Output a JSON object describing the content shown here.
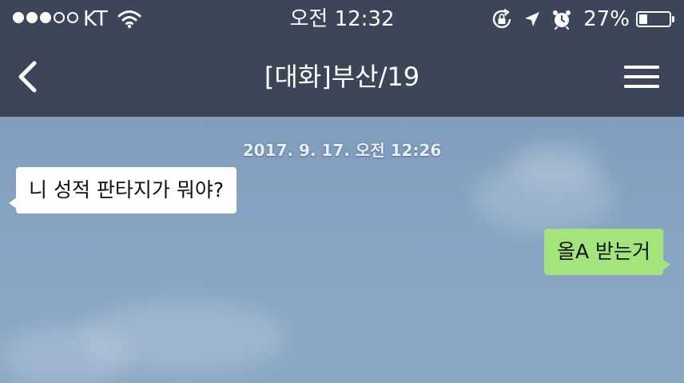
{
  "status_bar": {
    "signal_bars_filled": 3,
    "signal_bars_total": 5,
    "carrier": "KT",
    "time": "오전 12:32",
    "battery_percent_label": "27%",
    "battery_level": 0.27,
    "icons": [
      "wifi-icon",
      "orientation-lock-icon",
      "location-arrow-icon",
      "alarm-icon",
      "battery-icon"
    ]
  },
  "nav": {
    "back_icon": "chevron-left-icon",
    "title": "[대화]부산/19",
    "menu_icon": "hamburger-menu-icon"
  },
  "chat": {
    "timestamp": "2017. 9. 17. 오전 12:26",
    "messages": [
      {
        "direction": "incoming",
        "text": "니 성적 판타지가 뭐야?"
      },
      {
        "direction": "outgoing",
        "text": "올A 받는거"
      }
    ]
  },
  "colors": {
    "header_bg": "#3d4658",
    "chat_bg": "#88a5c4",
    "incoming_bubble": "#ffffff",
    "outgoing_bubble": "#a3e47c"
  }
}
